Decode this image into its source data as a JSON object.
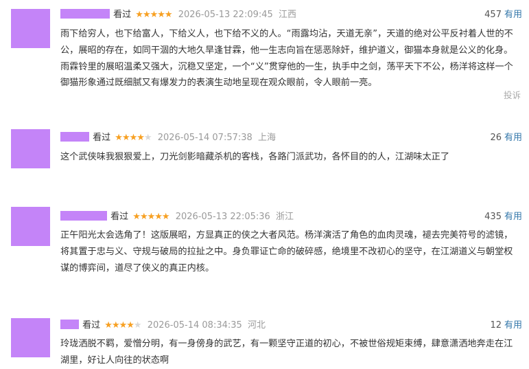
{
  "reviews": [
    {
      "user_tail": "",
      "status": "看过",
      "rating": 5,
      "time": "2026-05-13 22:09:45",
      "location": "江西",
      "votes": "457",
      "useful_label": "有用",
      "content": "雨下给穷人，也下给富人，下给义人，也下给不义的人。“雨露均沾，天道无亲”，天道的绝对公平反衬着人世的不公，展昭的存在，如同干涸的大地久旱逢甘霖，他一生志向旨在惩恶除奸，维护道义，御猫本身就是公义的化身。雨霖铃里的展昭温柔又强大，沉稳又坚定，一个“义”贯穿他的一生，执手中之剑，荡平天下不公，杨洋将这样一个御猫形象通过既细腻又有爆发力的表演生动地呈现在观众眼前，令人眼前一亮。",
      "report_label": "投诉"
    },
    {
      "user_tail": "",
      "status": "看过",
      "rating": 4,
      "time": "2026-05-14 07:57:38",
      "location": "上海",
      "votes": "26",
      "useful_label": "有用",
      "content": "这个武侠味我狠狠爱上，刀光剑影暗藏杀机的客栈，各路门派武功，各怀目的的人，江湖味太正了"
    },
    {
      "user_tail": "",
      "status": "看过",
      "rating": 5,
      "time": "2026-05-13 22:05:36",
      "location": "浙江",
      "votes": "435",
      "useful_label": "有用",
      "content": "正午阳光太会选角了！这版展昭，方显真正的侠之大者风范。杨洋演活了角色的血肉灵魂，褪去完美符号的滤镜，将其置于忠与义、守规与破局的拉扯之中。身负罪证亡命的破碎感，绝境里不改初心的坚守，在江湖道义与朝堂权谋的博弈间，道尽了侠义的真正内核。"
    },
    {
      "user_tail": "",
      "status": "看过",
      "rating": 4,
      "time": "2026-05-14 08:34:35",
      "location": "河北",
      "votes": "12",
      "useful_label": "有用",
      "content": "玲珑洒脱不羁，爱憎分明，有一身傍身的武艺，有一颗坚守正道的初心，不被世俗规矩束缚，肆意潇洒地奔走在江湖里，好让人向往的状态啊"
    }
  ],
  "colors": {
    "star_on": "#f7a022",
    "star_off": "#d8d8d8",
    "useful_link": "#3377aa",
    "avatar_placeholder": "#c484f8"
  }
}
